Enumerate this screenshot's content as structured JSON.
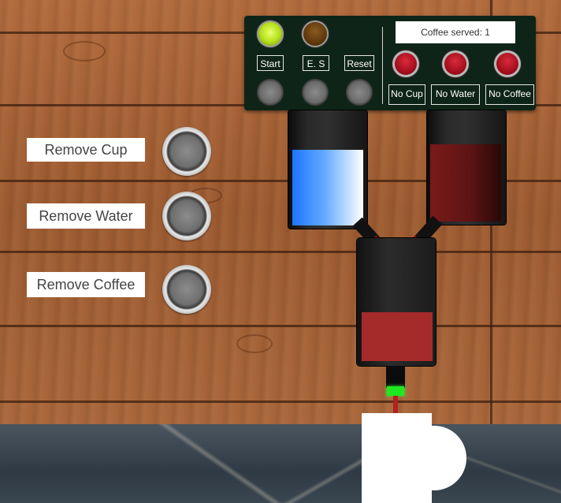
{
  "panel": {
    "start_label": "Start",
    "es_label": "E. S",
    "reset_label": "Reset",
    "display_text": "Coffee served: 1",
    "no_cup_label": "No Cup",
    "no_water_label": "No Water",
    "no_coffee_label": "No Coffee",
    "colors": {
      "running_lamp": "#b7e21a",
      "es_lamp": "#5b3509",
      "warning_lamps": "#9a0a18",
      "panel_bg": "#0f2418"
    }
  },
  "side_controls": [
    {
      "label": "Remove Cup"
    },
    {
      "label": "Remove Water"
    },
    {
      "label": "Remove Coffee"
    }
  ],
  "machine": {
    "water_color": "#1e74ff",
    "coffee_color": "#7a1a1a",
    "valve_color": "#ff1a1a",
    "indicator_color": "#1fe820"
  }
}
